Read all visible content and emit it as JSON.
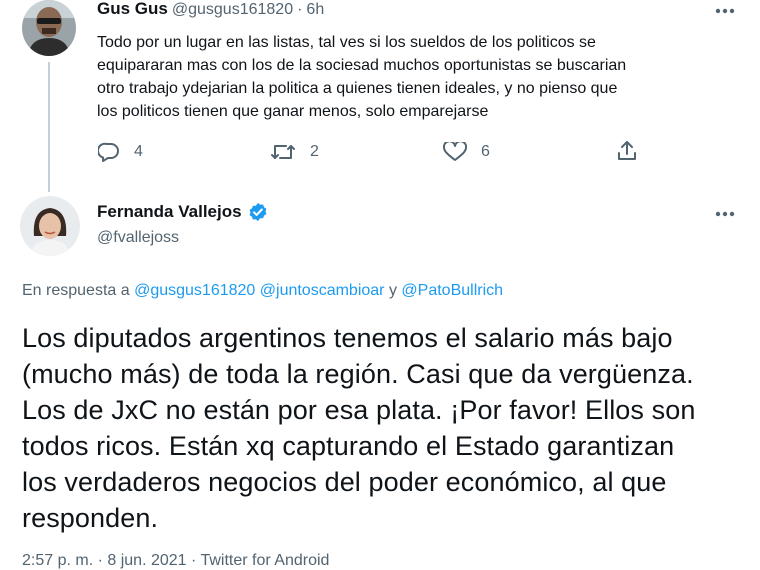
{
  "reply_tweet": {
    "author_name": "Gus Gus",
    "author_handle": "@gusgus161820",
    "separator": "·",
    "time_ago": "6h",
    "text_lines": [
      "Todo por un lugar en las listas, tal ves si los sueldos de los politicos se",
      "equipararan mas con los de la sociesad muchos oportunistas se buscarian",
      "otro trabajo ydejarian la politica a quienes tienen ideales, y no pienso que",
      "los politicos tienen que ganar menos, solo emparejarse"
    ],
    "actions": {
      "reply_count": "4",
      "retweet_count": "2",
      "like_count": "6"
    },
    "icons": [
      "comment-icon",
      "retweet-icon",
      "heart-icon",
      "share-icon",
      "more-icon"
    ]
  },
  "main_tweet": {
    "author_name": "Fernanda Vallejos",
    "author_handle": "@fvallejoss",
    "verified": true,
    "reply_prefix": "En respuesta a",
    "reply_mention_1": "@gusgus161820",
    "reply_mention_2": "@juntoscambioar",
    "reply_and": "y",
    "reply_mention_3": "@PatoBullrich",
    "text_lines": [
      "Los diputados argentinos tenemos el salario más bajo",
      "(mucho más) de toda la región. Casi que da vergüenza.",
      "Los de JxC no están por esa plata. ¡Por favor! Ellos son",
      "todos ricos. Están xq capturando el Estado garantizan",
      "los verdaderos negocios del poder económico, al que",
      "responden."
    ],
    "timestamp": "2:57 p. m. · 8 jun. 2021 · Twitter for Android"
  },
  "colors": {
    "text": "#0f1419",
    "muted": "#536471",
    "link": "#1d9bf0",
    "verified": "#1d9bf0",
    "thread_line": "#c4cfd6"
  }
}
